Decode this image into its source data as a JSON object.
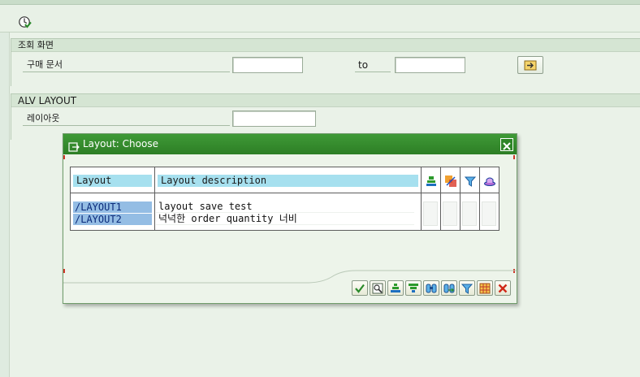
{
  "toolbar": {
    "execute_icon": "execute-icon"
  },
  "search_group": {
    "title": "조회 화면",
    "field_label": "구매 문서",
    "from_value": "",
    "to_label": "to",
    "to_value": "",
    "multi_select_icon": "arrow-right-icon"
  },
  "alv_group": {
    "title": "ALV LAYOUT",
    "field_label": "레이아웃",
    "value": ""
  },
  "dialog": {
    "title": "Layout: Choose",
    "grid": {
      "columns": [
        "Layout",
        "Layout description"
      ],
      "header_icons": [
        "default-layout-icon",
        "user-specific-icon",
        "filter-icon",
        "hat-icon"
      ],
      "rows": [
        {
          "layout": "/LAYOUT1",
          "description": "layout save test"
        },
        {
          "layout": "/LAYOUT2",
          "description": "넉넉한 order quantity 너비"
        }
      ]
    },
    "buttons": [
      "continue-icon",
      "details-icon",
      "sort-ascending-icon",
      "sort-descending-icon",
      "find-icon",
      "find-next-icon",
      "filter-icon",
      "layout-icon",
      "cancel-icon"
    ]
  },
  "colors": {
    "title_bar": "#2f8a27",
    "header_cell": "#a6e0ef",
    "key_cell": "#94bde4",
    "background": "#dfebe0"
  }
}
